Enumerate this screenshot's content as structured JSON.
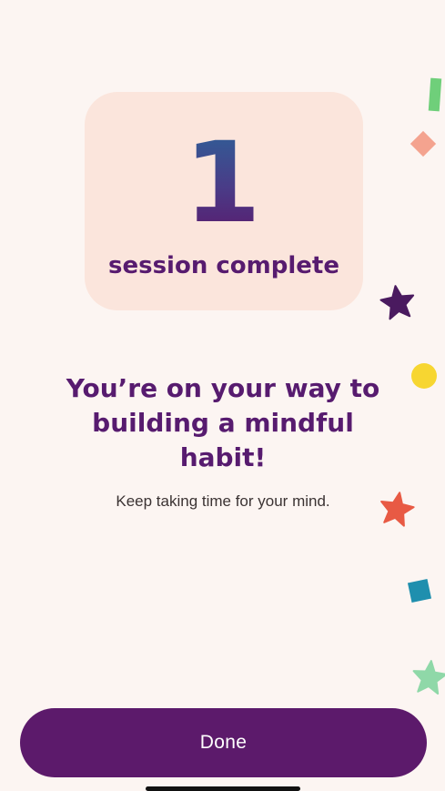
{
  "summary": {
    "count": "1",
    "count_label": "session complete"
  },
  "message": {
    "headline": "You’re on your way to building a mindful habit!",
    "subtext": "Keep taking time for your mind."
  },
  "actions": {
    "done_label": "Done"
  },
  "colors": {
    "background": "#fcf5f2",
    "card": "#fbe5dc",
    "primary_purple": "#5c1a6b",
    "number_gradient_top": "#2f5f97",
    "number_gradient_bottom": "#5a1a6d"
  },
  "confetti": [
    {
      "shape": "rectangle",
      "color": "#6fcf7a"
    },
    {
      "shape": "diamond",
      "color": "#f4a38f"
    },
    {
      "shape": "star",
      "color": "#4a1a5f"
    },
    {
      "shape": "circle",
      "color": "#f7d631"
    },
    {
      "shape": "star",
      "color": "#e85a44"
    },
    {
      "shape": "square",
      "color": "#1f8fae"
    },
    {
      "shape": "star",
      "color": "#8fd8a8"
    }
  ]
}
